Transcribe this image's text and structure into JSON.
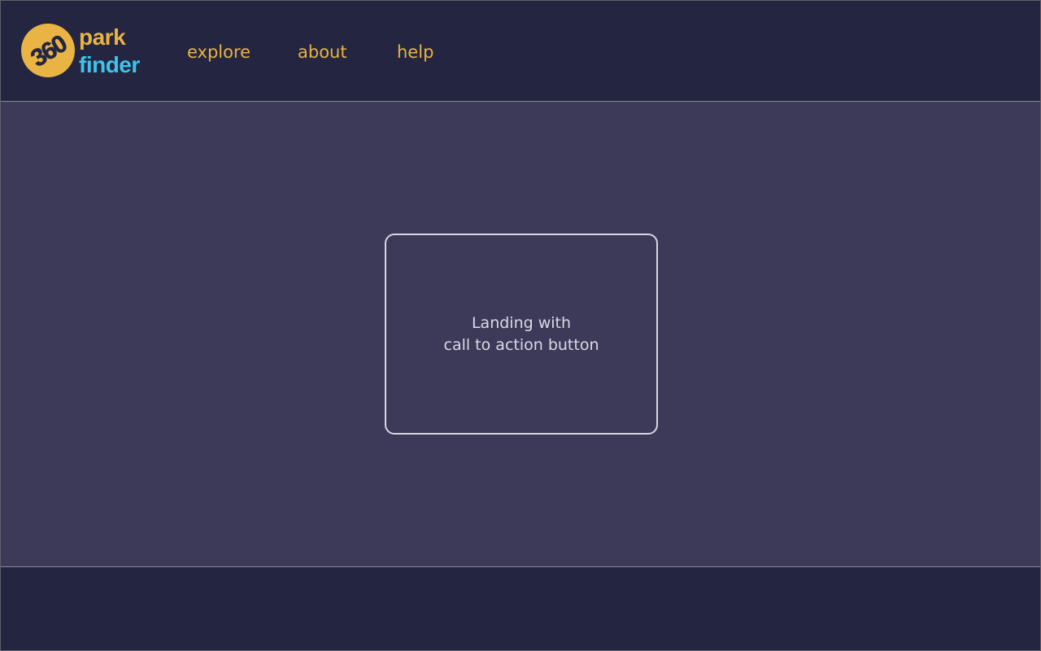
{
  "colors": {
    "header_bg": "#232541",
    "main_bg": "#3c3959",
    "footer_bg": "#232541",
    "accent_gold": "#e9b443",
    "accent_cyan": "#3ec3ec",
    "box_border": "#d8d6e4",
    "box_text": "#dcdae6"
  },
  "header": {
    "logo": {
      "badge_text": "360",
      "word_top": "park",
      "word_bottom": "finder",
      "badge_icon": "circle-badge-icon"
    },
    "nav": [
      {
        "label": "explore"
      },
      {
        "label": "about"
      },
      {
        "label": "help"
      }
    ]
  },
  "main": {
    "placeholder": {
      "line1": "Landing with",
      "line2": "call to action button"
    }
  },
  "footer": {}
}
